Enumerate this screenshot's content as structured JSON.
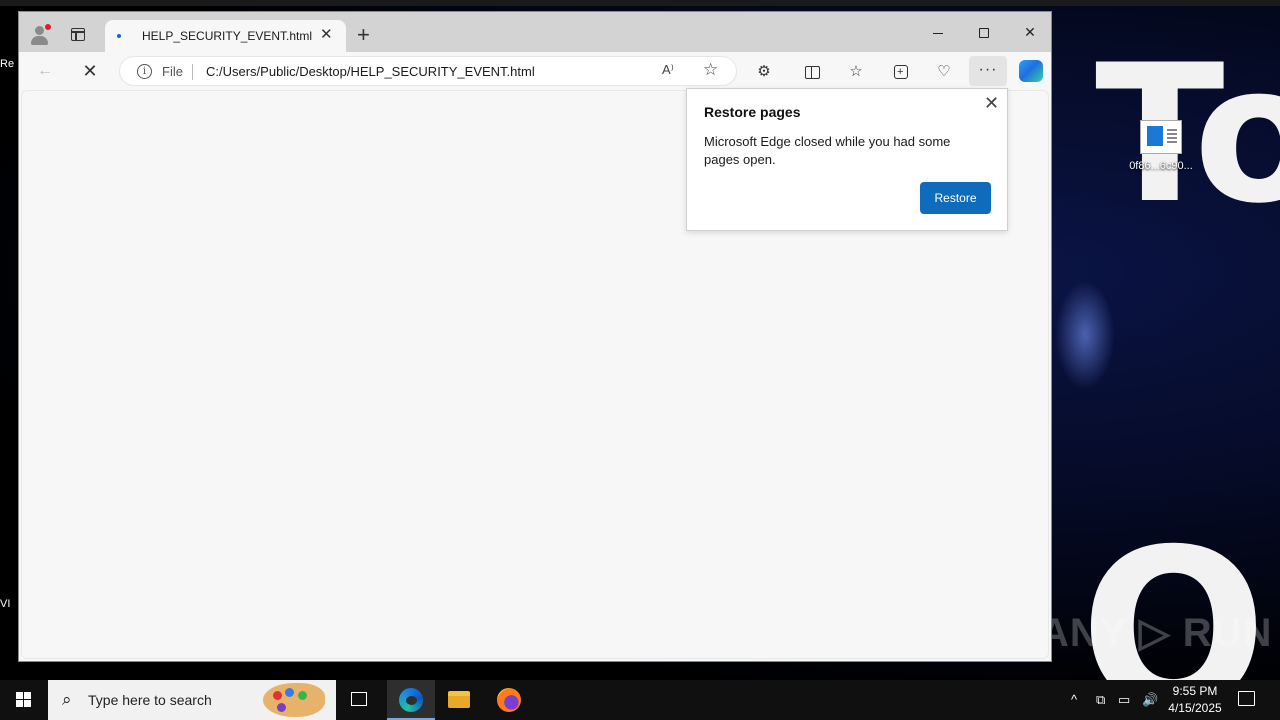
{
  "browser": {
    "tab": {
      "title": "HELP_SECURITY_EVENT.html",
      "close": "✕"
    },
    "new_tab": "+",
    "address": {
      "scheme": "File",
      "url": "C:/Users/Public/Desktop/HELP_SECURITY_EVENT.html",
      "read_aloud": "A⁾",
      "favorite": "☆"
    },
    "toolbar": {
      "back": "←",
      "stop": "✕",
      "extensions": "⚙",
      "favorites": "☆",
      "performance": "♡",
      "more": "···"
    },
    "window_controls": {
      "close": "✕"
    }
  },
  "restore_popup": {
    "title": "Restore pages",
    "message": "Microsoft Edge closed while you had some pages open.",
    "button": "Restore",
    "close": "✕"
  },
  "desktop": {
    "icon_label": "0f86...6c90...",
    "bg_text_top": "To",
    "bg_text_bottom": "O",
    "watermark": "ANY ▷ RUN",
    "left_edge": [
      "Re",
      "VI"
    ]
  },
  "taskbar": {
    "search_placeholder": "Type here to search",
    "search_icon": "⌕",
    "tray_up": "^",
    "tray_network": "⧉",
    "tray_display": "▭",
    "tray_volume": "🔊",
    "time": "9:55 PM",
    "date": "4/15/2025"
  },
  "colors": {
    "accent": "#0f6cbd",
    "taskbar": "#101010",
    "titlebar": "#d3d3d3"
  }
}
